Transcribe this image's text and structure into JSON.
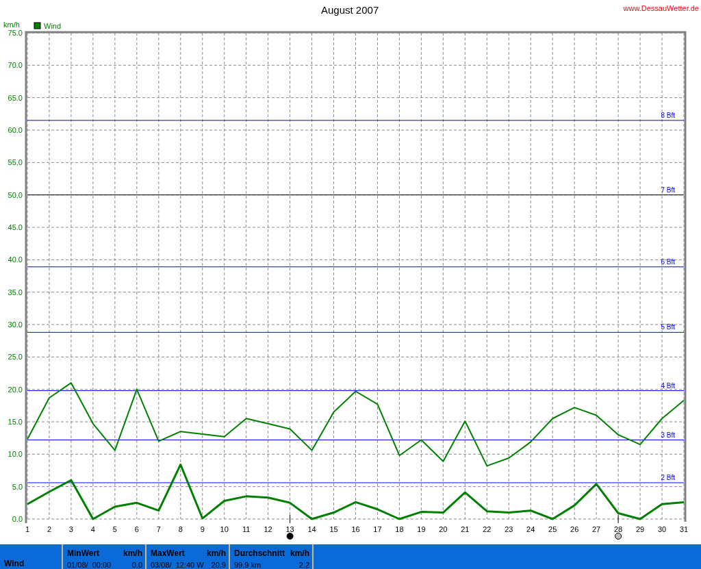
{
  "header": {
    "title": "August 2007",
    "site": "www.DessauWetter.de"
  },
  "chart": {
    "chart_data": {
      "type": "line",
      "ylabel": "km/h",
      "x": [
        1,
        2,
        3,
        4,
        5,
        6,
        7,
        8,
        9,
        10,
        11,
        12,
        13,
        14,
        15,
        16,
        17,
        18,
        19,
        20,
        21,
        22,
        23,
        24,
        25,
        26,
        27,
        28,
        29,
        30,
        31
      ],
      "series": [
        {
          "name": "Wind",
          "color": "#008000",
          "values": [
            2.3,
            4.2,
            6.0,
            0.0,
            1.9,
            2.5,
            1.3,
            8.4,
            0.1,
            2.8,
            3.5,
            3.3,
            2.5,
            0.0,
            1.0,
            2.6,
            1.5,
            0.0,
            1.1,
            1.0,
            4.1,
            1.2,
            1.0,
            1.3,
            0.0,
            2.1,
            5.4,
            0.9,
            0.0,
            2.3,
            2.6
          ]
        },
        {
          "color": "#008000",
          "values": [
            12.3,
            18.7,
            21.0,
            14.7,
            10.6,
            20.0,
            12.0,
            13.5,
            13.1,
            12.7,
            15.5,
            14.7,
            13.9,
            10.6,
            16.5,
            19.7,
            17.7,
            9.8,
            12.2,
            8.9,
            15.1,
            8.2,
            9.4,
            11.9,
            15.5,
            17.2,
            16.0,
            13.0,
            11.5,
            15.5,
            18.3
          ]
        }
      ],
      "xlim": [
        1,
        31
      ],
      "ylim": [
        0,
        75
      ],
      "xticks": [
        1,
        2,
        3,
        4,
        5,
        6,
        7,
        8,
        9,
        10,
        11,
        12,
        13,
        14,
        15,
        16,
        17,
        18,
        19,
        20,
        21,
        22,
        23,
        24,
        25,
        26,
        27,
        28,
        29,
        30,
        31
      ],
      "yticks": [
        {
          "value": 0,
          "label": "0.0"
        },
        {
          "value": 5,
          "label": "5.0"
        },
        {
          "value": 10,
          "label": "10.0"
        },
        {
          "value": 15,
          "label": "15.0"
        },
        {
          "value": 20,
          "label": "20.0"
        },
        {
          "value": 25,
          "label": "25.0"
        },
        {
          "value": 30,
          "label": "30.0"
        },
        {
          "value": 35,
          "label": "35.0"
        },
        {
          "value": 40,
          "label": "40.0"
        },
        {
          "value": 45,
          "label": "45.0"
        },
        {
          "value": 50,
          "label": "50.0"
        },
        {
          "value": 55,
          "label": "55.0"
        },
        {
          "value": 60,
          "label": "60.0"
        },
        {
          "value": 65,
          "label": "65.0"
        },
        {
          "value": 70,
          "label": "70.0"
        },
        {
          "value": 75,
          "label": "75.0"
        }
      ],
      "grid": true,
      "ref_lines": [
        {
          "axis": "y",
          "value": 5.6,
          "label": "2 Bft",
          "color": "#0000ff"
        },
        {
          "axis": "y",
          "value": 12.2,
          "label": "3 Bft",
          "color": "#0000ff"
        },
        {
          "axis": "y",
          "value": 19.8,
          "label": "4 Bft",
          "color": "#0000ff"
        },
        {
          "axis": "y",
          "value": 28.8,
          "label": "5 Bft",
          "color": "#0000ff"
        },
        {
          "axis": "y",
          "value": 38.9,
          "label": "6 Bft",
          "color": "#0000ff"
        },
        {
          "axis": "y",
          "value": 50.0,
          "label": "7 Bft",
          "color": "#000000"
        },
        {
          "axis": "y",
          "value": 61.5,
          "label": "8 Bft",
          "color": "#0000ff"
        }
      ]
    },
    "moon_phases": [
      {
        "kind": "new_moon",
        "day": "13"
      },
      {
        "kind": "full_moon",
        "day": "28"
      }
    ]
  },
  "summary": {
    "label": "Wind",
    "columns": [
      {
        "heading": "MinWert",
        "unit": "km/h",
        "detail": "01/08/  00:00",
        "value": "0.0"
      },
      {
        "heading": "MaxWert",
        "unit": "km/h",
        "detail": "03/08/  12:40 W",
        "value": "20.9"
      },
      {
        "heading": "Durchschnitt",
        "unit": "km/h",
        "detail": "99.9 km",
        "value": "2.2"
      }
    ]
  }
}
